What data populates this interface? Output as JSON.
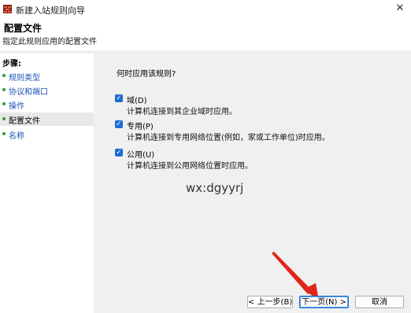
{
  "window": {
    "title": "新建入站规则向导",
    "close_glyph": "✕"
  },
  "header": {
    "title": "配置文件",
    "subtitle": "指定此规则应用的配置文件"
  },
  "steps": {
    "title": "步骤:",
    "items": [
      {
        "label": "规则类型"
      },
      {
        "label": "协议和端口"
      },
      {
        "label": "操作"
      },
      {
        "label": "配置文件"
      },
      {
        "label": "名称"
      }
    ]
  },
  "main": {
    "question": "何时应用该规则?",
    "options": [
      {
        "label": "域(D)",
        "description": "计算机连接到其企业域时应用。",
        "checked": true
      },
      {
        "label": "专用(P)",
        "description": "计算机连接到专用网络位置(例如，家或工作单位)时应用。",
        "checked": true
      },
      {
        "label": "公用(U)",
        "description": "计算机连接到公用网络位置时应用。",
        "checked": true
      }
    ],
    "check_glyph": "✓"
  },
  "watermark": "wx:dgyyrj",
  "buttons": {
    "back": "< 上一步(B)",
    "next": "下一页(N) >",
    "cancel": "取消"
  },
  "colors": {
    "accent": "#1f6bd2",
    "step_link": "#1a55b5",
    "step_dot": "#2e9c3a",
    "arrow": "#e0251b"
  },
  "icons": {
    "title": "firewall-icon",
    "close": "close-icon",
    "step_bullet": "green-dot-icon"
  }
}
